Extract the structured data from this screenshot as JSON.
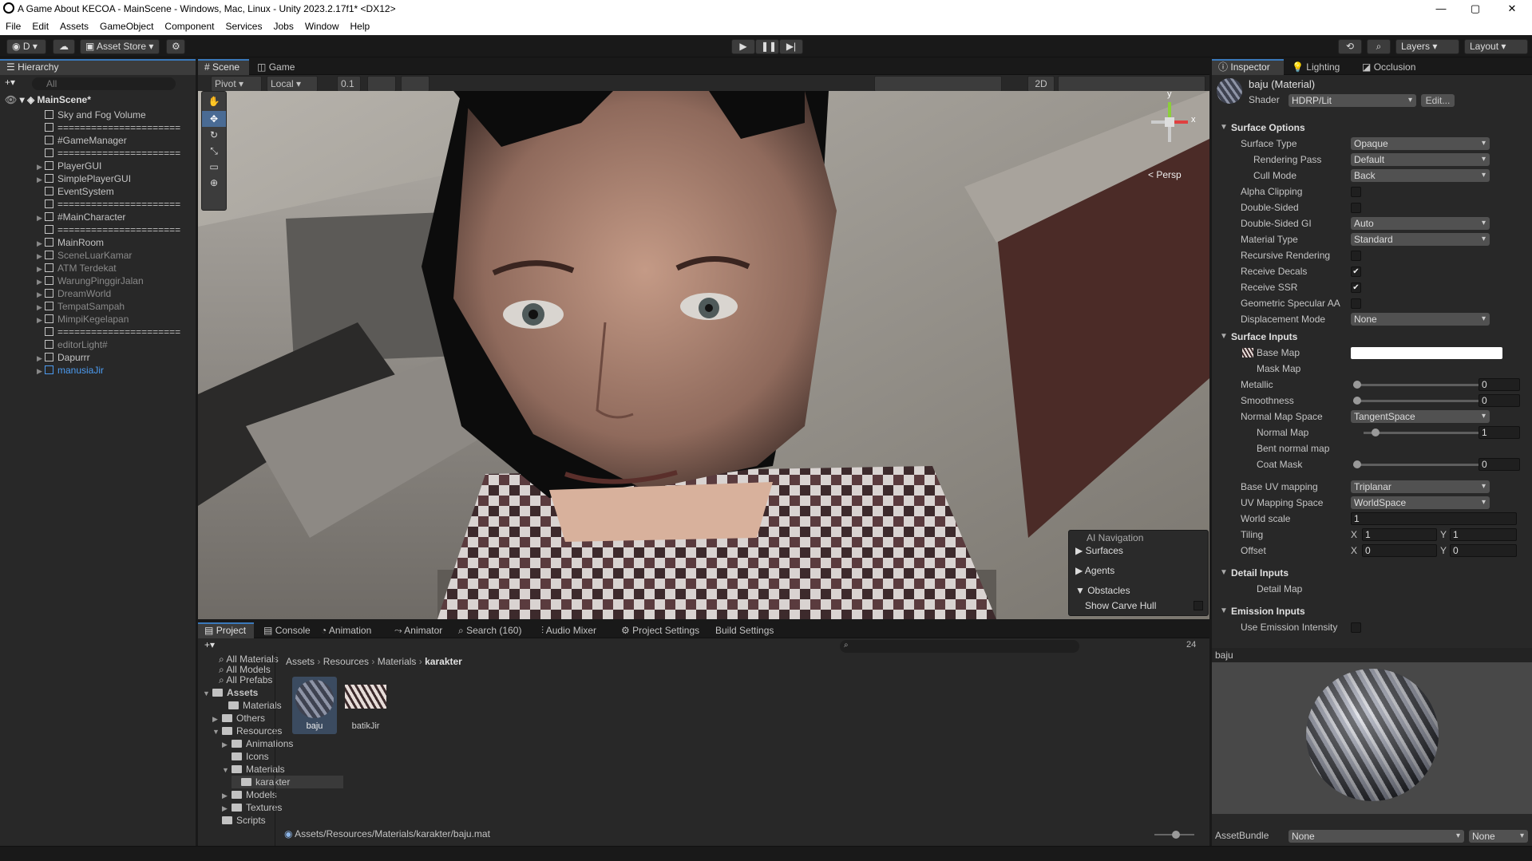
{
  "window": {
    "title": "A Game About KECOA - MainScene - Windows, Mac, Linux - Unity 2023.2.17f1* <DX12>",
    "minimize": "—",
    "maximize": "▢",
    "close": "✕"
  },
  "menu": [
    "File",
    "Edit",
    "Assets",
    "GameObject",
    "Component",
    "Services",
    "Jobs",
    "Window",
    "Help"
  ],
  "toolbar": {
    "account": "D",
    "asset_store": "Asset Store",
    "layers": "Layers",
    "layout": "Layout"
  },
  "hierarchy": {
    "tab": "Hierarchy",
    "search_placeholder": "All",
    "scene": "MainScene*",
    "items": [
      {
        "label": "Sky and Fog Volume",
        "state": "normal",
        "arrow": false
      },
      {
        "label": "======================",
        "state": "normal",
        "arrow": false
      },
      {
        "label": "#GameManager",
        "state": "normal",
        "arrow": false
      },
      {
        "label": "======================",
        "state": "normal",
        "arrow": false
      },
      {
        "label": "PlayerGUI",
        "state": "normal",
        "arrow": true
      },
      {
        "label": "SimplePlayerGUI",
        "state": "normal",
        "arrow": true
      },
      {
        "label": "EventSystem",
        "state": "normal",
        "arrow": false
      },
      {
        "label": "======================",
        "state": "normal",
        "arrow": false
      },
      {
        "label": "#MainCharacter",
        "state": "normal",
        "arrow": true
      },
      {
        "label": "======================",
        "state": "normal",
        "arrow": false
      },
      {
        "label": "MainRoom",
        "state": "normal",
        "arrow": true
      },
      {
        "label": "SceneLuarKamar",
        "state": "dim",
        "arrow": true
      },
      {
        "label": "ATM Terdekat",
        "state": "dim",
        "arrow": true
      },
      {
        "label": "WarungPinggirJalan",
        "state": "dim",
        "arrow": true
      },
      {
        "label": "DreamWorld",
        "state": "dim",
        "arrow": true
      },
      {
        "label": "TempatSampah",
        "state": "dim",
        "arrow": true
      },
      {
        "label": "MimpiKegelapan",
        "state": "dim",
        "arrow": true
      },
      {
        "label": "======================",
        "state": "normal",
        "arrow": false
      },
      {
        "label": "editorLight#",
        "state": "dim",
        "arrow": false
      },
      {
        "label": "Dapurrr",
        "state": "normal",
        "arrow": true
      },
      {
        "label": "manusiaJir",
        "state": "blue",
        "arrow": true
      }
    ]
  },
  "scene": {
    "tabs": [
      "Scene",
      "Game"
    ],
    "pivot": "Pivot",
    "local": "Local",
    "snap": "0.1",
    "mode2d": "2D",
    "persp": "< Persp",
    "gizmo": {
      "y": "y",
      "x": "x"
    },
    "ai_nav": {
      "title": "AI Navigation",
      "items": [
        "Surfaces",
        "Agents",
        "Obstacles"
      ],
      "show_carve": "Show Carve Hull"
    }
  },
  "project": {
    "tabs": [
      "Project",
      "Console",
      "Animation",
      "Animator",
      "Search (160)",
      "Audio Mixer",
      "Project Settings",
      "Build Settings"
    ],
    "hidden_count": "24",
    "favorites": [
      "All Materials",
      "All Models",
      "All Prefabs"
    ],
    "tree": [
      {
        "label": "Assets",
        "bold": true
      },
      {
        "label": "Materials"
      },
      {
        "label": "Others"
      },
      {
        "label": "Resources"
      },
      {
        "label": "Animations"
      },
      {
        "label": "Icons"
      },
      {
        "label": "Materials"
      },
      {
        "label": "karakter"
      },
      {
        "label": "Models"
      },
      {
        "label": "Textures"
      },
      {
        "label": "Scripts"
      }
    ],
    "breadcrumb": [
      "Assets",
      "Resources",
      "Materials",
      "karakter"
    ],
    "assets": [
      {
        "name": "baju"
      },
      {
        "name": "batikJir"
      }
    ],
    "path": "Assets/Resources/Materials/karakter/baju.mat"
  },
  "inspector": {
    "tabs": [
      "Inspector",
      "Lighting",
      "Occlusion"
    ],
    "title": "baju (Material)",
    "shader_label": "Shader",
    "shader": "HDRP/Lit",
    "edit": "Edit...",
    "surface_options": {
      "header": "Surface Options",
      "rows": [
        {
          "label": "Surface Type",
          "value": "Opaque",
          "kind": "dd",
          "indent": 1
        },
        {
          "label": "Rendering Pass",
          "value": "Default",
          "kind": "dd",
          "indent": 2
        },
        {
          "label": "Cull Mode",
          "value": "Back",
          "kind": "dd",
          "indent": 2
        },
        {
          "label": "Alpha Clipping",
          "value": "",
          "kind": "cb",
          "indent": 1
        },
        {
          "label": "Double-Sided",
          "value": "",
          "kind": "cb",
          "indent": 1
        },
        {
          "label": "Double-Sided GI",
          "value": "Auto",
          "kind": "dd",
          "indent": 1
        },
        {
          "label": "Material Type",
          "value": "Standard",
          "kind": "dd",
          "indent": 1
        },
        {
          "label": "Recursive Rendering",
          "value": "",
          "kind": "cb",
          "indent": 1
        },
        {
          "label": "Receive Decals",
          "value": "✔",
          "kind": "cb",
          "indent": 1
        },
        {
          "label": "Receive SSR",
          "value": "✔",
          "kind": "cb",
          "indent": 1
        },
        {
          "label": "Geometric Specular AA",
          "value": "",
          "kind": "cb",
          "indent": 1
        },
        {
          "label": "Displacement Mode",
          "value": "None",
          "kind": "dd",
          "indent": 1
        }
      ]
    },
    "surface_inputs": {
      "header": "Surface Inputs",
      "base_map": "Base Map",
      "mask_map": "Mask Map",
      "metallic": "Metallic",
      "metallic_val": "0",
      "smoothness": "Smoothness",
      "smoothness_val": "0",
      "normal_space_label": "Normal Map Space",
      "normal_space": "TangentSpace",
      "normal_map": "Normal Map",
      "normal_val": "1",
      "bent_normal": "Bent normal map",
      "coat_mask": "Coat Mask",
      "coat_val": "0",
      "base_uv_label": "Base UV mapping",
      "base_uv": "Triplanar",
      "uv_space_label": "UV Mapping Space",
      "uv_space": "WorldSpace",
      "world_scale_label": "World scale",
      "world_scale": "1",
      "tiling": "Tiling",
      "tiling_x": "1",
      "tiling_y": "1",
      "offset": "Offset",
      "offset_x": "0",
      "offset_y": "0",
      "x": "X",
      "y": "Y"
    },
    "detail_inputs": {
      "header": "Detail Inputs",
      "detail_map": "Detail Map"
    },
    "emission_inputs": {
      "header": "Emission Inputs",
      "use_intensity": "Use Emission Intensity"
    },
    "preview_name": "baju",
    "assetbundle_label": "AssetBundle",
    "assetbundle": "None",
    "assetbundle_variant": "None"
  }
}
